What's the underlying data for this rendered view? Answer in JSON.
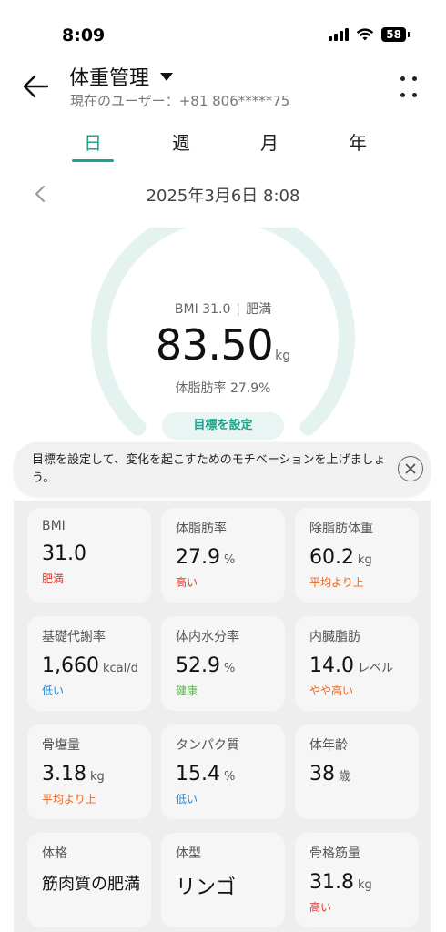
{
  "status_bar": {
    "time": "8:09",
    "battery": "58"
  },
  "header": {
    "title": "体重管理",
    "subtitle": "現在のユーザー：+81 806*****75"
  },
  "tabs": [
    {
      "label": "日",
      "active": true
    },
    {
      "label": "週",
      "active": false
    },
    {
      "label": "月",
      "active": false
    },
    {
      "label": "年",
      "active": false
    }
  ],
  "date": "2025年3月6日 8:08",
  "summary": {
    "bmi_text": "BMI 31.0",
    "bmi_status": "肥満",
    "weight": "83.50",
    "weight_unit": "kg",
    "fat_text": "体脂肪率 27.9%",
    "goal_button": "目標を設定"
  },
  "tip": {
    "text": "目標を設定して、変化を起こすためのモチベーションを上げましょう。"
  },
  "colors": {
    "accent": "#22a088",
    "gauge": "#e4f3f0",
    "red": "#e5332a",
    "orange": "#f0661e",
    "blue": "#1f86d6",
    "green": "#4cc23a"
  },
  "metrics": [
    {
      "label": "BMI",
      "value": "31.0",
      "unit": "",
      "status": "肥満",
      "status_color": "#e5332a"
    },
    {
      "label": "体脂肪率",
      "value": "27.9",
      "unit": "%",
      "status": "高い",
      "status_color": "#e5332a"
    },
    {
      "label": "除脂肪体重",
      "value": "60.2",
      "unit": "kg",
      "status": "平均より上",
      "status_color": "#f0661e"
    },
    {
      "label": "基礎代謝率",
      "value": "1,660",
      "unit": "kcal/d",
      "status": "低い",
      "status_color": "#1f86d6"
    },
    {
      "label": "体内水分率",
      "value": "52.9",
      "unit": "%",
      "status": "健康",
      "status_color": "#4cc23a"
    },
    {
      "label": "内臓脂肪",
      "value": "14.0",
      "unit": "レベル",
      "status": "やや高い",
      "status_color": "#f0661e"
    },
    {
      "label": "骨塩量",
      "value": "3.18",
      "unit": "kg",
      "status": "平均より上",
      "status_color": "#f0661e"
    },
    {
      "label": "タンパク質",
      "value": "15.4",
      "unit": "%",
      "status": "低い",
      "status_color": "#1f86d6"
    },
    {
      "label": "体年齢",
      "value": "38",
      "unit": "歳",
      "status": "",
      "status_color": ""
    },
    {
      "label": "体格",
      "value": "筋肉質の肥満",
      "unit": "",
      "status": "",
      "status_color": "",
      "text": true
    },
    {
      "label": "体型",
      "value": "リンゴ",
      "unit": "",
      "status": "",
      "status_color": "",
      "text_big": true
    },
    {
      "label": "骨格筋量",
      "value": "31.8",
      "unit": "kg",
      "status": "高い",
      "status_color": "#e5332a"
    }
  ]
}
